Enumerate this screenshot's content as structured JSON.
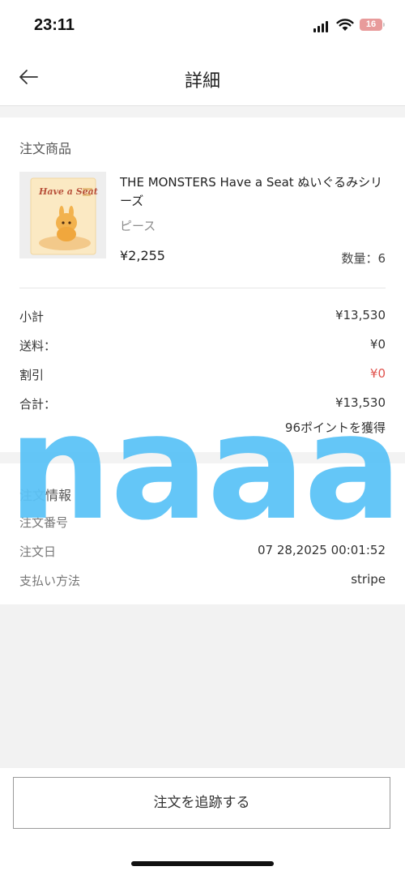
{
  "status_bar": {
    "time": "23:11",
    "battery": "16"
  },
  "header": {
    "title": "詳細"
  },
  "order_items": {
    "section_title": "注文商品",
    "product": {
      "name": "THE MONSTERS Have a Seat ぬいぐるみシリーズ",
      "variant": "ピース",
      "price": "¥2,255",
      "quantity": "数量：6",
      "image_text": "Have a Seat"
    },
    "subtotal_label": "小計",
    "subtotal_value": "¥13,530",
    "shipping_label": "送料：",
    "shipping_value": "¥0",
    "discount_label": "割引",
    "discount_value": "¥0",
    "total_label": "合計：",
    "total_value": "¥13,530",
    "points": "96ポイントを獲得"
  },
  "order_info": {
    "section_title": "注文情報",
    "order_number_label": "注文番号",
    "order_date_label": "注文日",
    "order_date_value": "07 28,2025 00:01:52",
    "payment_label": "支払い方法",
    "payment_value": "stripe"
  },
  "footer": {
    "track_button": "注文を追跡する"
  },
  "watermark": {
    "text": "naaa"
  },
  "colors": {
    "accent_red": "#e0524d",
    "watermark": "#5cc3f7",
    "battery": "#e89b9b"
  }
}
